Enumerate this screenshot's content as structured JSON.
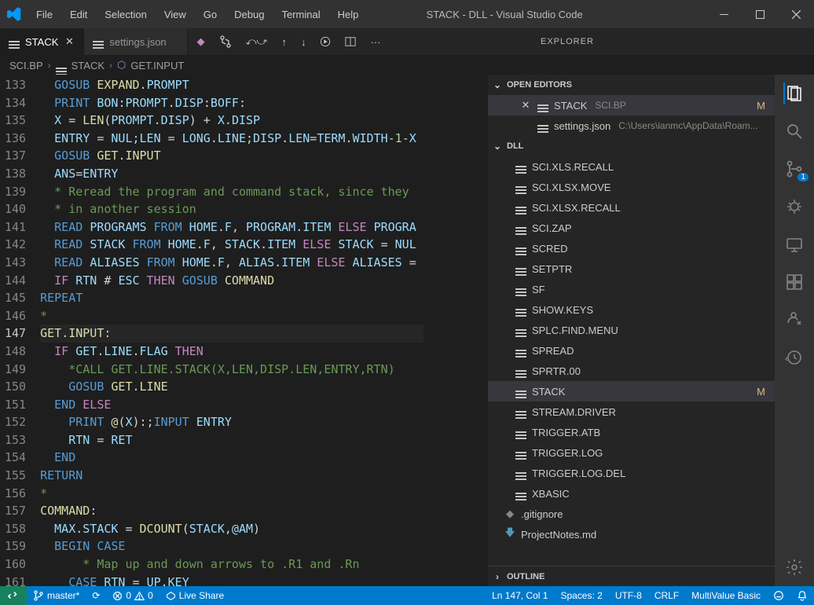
{
  "titlebar": {
    "menus": [
      "File",
      "Edit",
      "Selection",
      "View",
      "Go",
      "Debug",
      "Terminal",
      "Help"
    ],
    "title": "STACK - DLL - Visual Studio Code"
  },
  "tabs": [
    {
      "label": "STACK",
      "active": true,
      "dirty": false,
      "close": true
    },
    {
      "label": "settings.json",
      "active": false,
      "dirty": false,
      "close": false
    }
  ],
  "panel_title": "EXPLORER",
  "breadcrumb": [
    "SCI.BP",
    "STACK",
    "GET.INPUT"
  ],
  "line_numbers": [
    133,
    134,
    135,
    136,
    137,
    138,
    139,
    140,
    141,
    142,
    143,
    144,
    145,
    146,
    147,
    148,
    149,
    150,
    151,
    152,
    153,
    154,
    155,
    156,
    157,
    158,
    159,
    160,
    161
  ],
  "active_line_number": 147,
  "code_lines": [
    [
      [
        "  ",
        "op"
      ],
      [
        "GOSUB ",
        "kw"
      ],
      [
        "EXPAND",
        "fn"
      ],
      [
        ".",
        "op"
      ],
      [
        "PROMPT",
        "var"
      ]
    ],
    [
      [
        "  ",
        "op"
      ],
      [
        "PRINT ",
        "kw"
      ],
      [
        "BON",
        "var"
      ],
      [
        ":",
        "op"
      ],
      [
        "PROMPT",
        "var"
      ],
      [
        ".",
        "op"
      ],
      [
        "DISP",
        "var"
      ],
      [
        ":",
        "op"
      ],
      [
        "BOFF",
        "var"
      ],
      [
        ":",
        "op"
      ]
    ],
    [
      [
        "  ",
        "op"
      ],
      [
        "X",
        "var"
      ],
      [
        " = ",
        "op"
      ],
      [
        "LEN",
        "fn"
      ],
      [
        "(",
        "op"
      ],
      [
        "PROMPT",
        "var"
      ],
      [
        ".",
        "op"
      ],
      [
        "DISP",
        "var"
      ],
      [
        ")",
        "op"
      ],
      [
        " + ",
        "op"
      ],
      [
        "X",
        "var"
      ],
      [
        ".",
        "op"
      ],
      [
        "DISP",
        "var"
      ]
    ],
    [
      [
        "  ",
        "op"
      ],
      [
        "ENTRY",
        "var"
      ],
      [
        " = ",
        "op"
      ],
      [
        "NUL",
        "var"
      ],
      [
        ";",
        "op"
      ],
      [
        "LEN",
        "var"
      ],
      [
        " = ",
        "op"
      ],
      [
        "LONG",
        "var"
      ],
      [
        ".",
        "op"
      ],
      [
        "LINE",
        "var"
      ],
      [
        ";",
        "op"
      ],
      [
        "DISP",
        "var"
      ],
      [
        ".",
        "op"
      ],
      [
        "LEN",
        "var"
      ],
      [
        "=",
        "op"
      ],
      [
        "TERM",
        "var"
      ],
      [
        ".",
        "op"
      ],
      [
        "WIDTH",
        "var"
      ],
      [
        "-",
        "op"
      ],
      [
        "1",
        "num"
      ],
      [
        "-",
        "op"
      ],
      [
        "X",
        "var"
      ]
    ],
    [
      [
        "  ",
        "op"
      ],
      [
        "GOSUB ",
        "kw"
      ],
      [
        "GET",
        "fn"
      ],
      [
        ".",
        "op"
      ],
      [
        "INPUT",
        "fn"
      ]
    ],
    [
      [
        "  ",
        "op"
      ],
      [
        "ANS",
        "var"
      ],
      [
        "=",
        "op"
      ],
      [
        "ENTRY",
        "var"
      ]
    ],
    [
      [
        "  ",
        "op"
      ],
      [
        "* Reread the program and command stack, since they ",
        "cmt"
      ]
    ],
    [
      [
        "  ",
        "op"
      ],
      [
        "* in another session",
        "cmt"
      ]
    ],
    [
      [
        "  ",
        "op"
      ],
      [
        "READ ",
        "kw"
      ],
      [
        "PROGRAMS ",
        "var"
      ],
      [
        "FROM ",
        "kw"
      ],
      [
        "HOME",
        "var"
      ],
      [
        ".",
        "op"
      ],
      [
        "F",
        "var"
      ],
      [
        ", ",
        "op"
      ],
      [
        "PROGRAM",
        "var"
      ],
      [
        ".",
        "op"
      ],
      [
        "ITEM",
        "var"
      ],
      [
        " ELSE ",
        "kw2"
      ],
      [
        "PROGRA",
        "var"
      ]
    ],
    [
      [
        "  ",
        "op"
      ],
      [
        "READ ",
        "kw"
      ],
      [
        "STACK ",
        "var"
      ],
      [
        "FROM ",
        "kw"
      ],
      [
        "HOME",
        "var"
      ],
      [
        ".",
        "op"
      ],
      [
        "F",
        "var"
      ],
      [
        ", ",
        "op"
      ],
      [
        "STACK",
        "var"
      ],
      [
        ".",
        "op"
      ],
      [
        "ITEM",
        "var"
      ],
      [
        " ELSE ",
        "kw2"
      ],
      [
        "STACK",
        "var"
      ],
      [
        " = ",
        "op"
      ],
      [
        "NUL",
        "var"
      ]
    ],
    [
      [
        "  ",
        "op"
      ],
      [
        "READ ",
        "kw"
      ],
      [
        "ALIASES ",
        "var"
      ],
      [
        "FROM ",
        "kw"
      ],
      [
        "HOME",
        "var"
      ],
      [
        ".",
        "op"
      ],
      [
        "F",
        "var"
      ],
      [
        ", ",
        "op"
      ],
      [
        "ALIAS",
        "var"
      ],
      [
        ".",
        "op"
      ],
      [
        "ITEM",
        "var"
      ],
      [
        " ELSE ",
        "kw2"
      ],
      [
        "ALIASES",
        "var"
      ],
      [
        " = ",
        "op"
      ]
    ],
    [
      [
        "  ",
        "op"
      ],
      [
        "IF ",
        "kw2"
      ],
      [
        "RTN",
        "var"
      ],
      [
        " # ",
        "op"
      ],
      [
        "ESC",
        "var"
      ],
      [
        " THEN ",
        "kw2"
      ],
      [
        "GOSUB ",
        "kw"
      ],
      [
        "COMMAND",
        "fn"
      ]
    ],
    [
      [
        "REPEAT",
        "kw"
      ]
    ],
    [
      [
        "*",
        "cmt"
      ]
    ],
    [
      [
        "GET",
        "lbl"
      ],
      [
        ".",
        "op"
      ],
      [
        "INPUT",
        "lbl"
      ],
      [
        ":",
        "op"
      ]
    ],
    [
      [
        "  ",
        "op"
      ],
      [
        "IF ",
        "kw2"
      ],
      [
        "GET",
        "var"
      ],
      [
        ".",
        "op"
      ],
      [
        "LINE",
        "var"
      ],
      [
        ".",
        "op"
      ],
      [
        "FLAG",
        "var"
      ],
      [
        " THEN",
        "kw2"
      ]
    ],
    [
      [
        "    ",
        "op"
      ],
      [
        "*CALL GET.LINE.STACK(X,LEN,DISP.LEN,ENTRY,RTN)",
        "cmt"
      ]
    ],
    [
      [
        "    ",
        "op"
      ],
      [
        "GOSUB ",
        "kw"
      ],
      [
        "GET",
        "fn"
      ],
      [
        ".",
        "op"
      ],
      [
        "LINE",
        "fn"
      ]
    ],
    [
      [
        "  ",
        "op"
      ],
      [
        "END ",
        "kw"
      ],
      [
        "ELSE",
        "kw2"
      ]
    ],
    [
      [
        "    ",
        "op"
      ],
      [
        "PRINT ",
        "kw"
      ],
      [
        "@",
        "fn"
      ],
      [
        "(",
        "op"
      ],
      [
        "X",
        "var"
      ],
      [
        ")",
        "op"
      ],
      [
        ":",
        "op"
      ],
      [
        ";",
        "op"
      ],
      [
        "INPUT ",
        "kw"
      ],
      [
        "ENTRY",
        "var"
      ]
    ],
    [
      [
        "    ",
        "op"
      ],
      [
        "RTN",
        "var"
      ],
      [
        " = ",
        "op"
      ],
      [
        "RET",
        "var"
      ]
    ],
    [
      [
        "  ",
        "op"
      ],
      [
        "END",
        "kw"
      ]
    ],
    [
      [
        "RETURN",
        "kw"
      ]
    ],
    [
      [
        "*",
        "cmt"
      ]
    ],
    [
      [
        "COMMAND",
        "lbl"
      ],
      [
        ":",
        "op"
      ]
    ],
    [
      [
        "  ",
        "op"
      ],
      [
        "MAX",
        "var"
      ],
      [
        ".",
        "op"
      ],
      [
        "STACK",
        "var"
      ],
      [
        " = ",
        "op"
      ],
      [
        "DCOUNT",
        "fn"
      ],
      [
        "(",
        "op"
      ],
      [
        "STACK",
        "var"
      ],
      [
        ",",
        "op"
      ],
      [
        "@AM",
        "var"
      ],
      [
        ")",
        "op"
      ]
    ],
    [
      [
        "  ",
        "op"
      ],
      [
        "BEGIN CASE",
        "kw"
      ]
    ],
    [
      [
        "      ",
        "op"
      ],
      [
        "* Map up and down arrows to .R1 and .Rn",
        "cmt"
      ]
    ],
    [
      [
        "    ",
        "op"
      ],
      [
        "CASE ",
        "kw"
      ],
      [
        "RTN",
        "var"
      ],
      [
        " = ",
        "op"
      ],
      [
        "UP",
        "var"
      ],
      [
        ".",
        "op"
      ],
      [
        "KEY",
        "var"
      ]
    ]
  ],
  "open_editors": {
    "title": "OPEN EDITORS",
    "items": [
      {
        "name": "STACK",
        "sub": "SCI.BP",
        "dirty": "M",
        "active": true,
        "close": true
      },
      {
        "name": "settings.json",
        "sub": "C:\\Users\\ianmc\\AppData\\Roam...",
        "dirty": "",
        "active": false,
        "close": false
      }
    ]
  },
  "folder": {
    "title": "DLL",
    "items": [
      {
        "name": "SCI.XLS.RECALL",
        "dirty": ""
      },
      {
        "name": "SCI.XLSX.MOVE",
        "dirty": ""
      },
      {
        "name": "SCI.XLSX.RECALL",
        "dirty": ""
      },
      {
        "name": "SCI.ZAP",
        "dirty": ""
      },
      {
        "name": "SCRED",
        "dirty": ""
      },
      {
        "name": "SETPTR",
        "dirty": ""
      },
      {
        "name": "SF",
        "dirty": ""
      },
      {
        "name": "SHOW.KEYS",
        "dirty": ""
      },
      {
        "name": "SPLC.FIND.MENU",
        "dirty": ""
      },
      {
        "name": "SPREAD",
        "dirty": ""
      },
      {
        "name": "SPRTR.00",
        "dirty": ""
      },
      {
        "name": "STACK",
        "dirty": "M",
        "active": true
      },
      {
        "name": "STREAM.DRIVER",
        "dirty": ""
      },
      {
        "name": "TRIGGER.ATB",
        "dirty": ""
      },
      {
        "name": "TRIGGER.LOG",
        "dirty": ""
      },
      {
        "name": "TRIGGER.LOG.DEL",
        "dirty": ""
      },
      {
        "name": "XBASIC",
        "dirty": ""
      }
    ],
    "root_items": [
      {
        "name": ".gitignore",
        "icon": "gitignore"
      },
      {
        "name": "ProjectNotes.md",
        "icon": "markdown"
      }
    ]
  },
  "outline": "OUTLINE",
  "source_control_badge": "1",
  "status": {
    "branch": "master*",
    "sync": "⟳",
    "errors": "0",
    "warnings": "0",
    "liveshare": "Live Share",
    "pos": "Ln 147, Col 1",
    "spaces": "Spaces: 2",
    "encoding": "UTF-8",
    "eol": "CRLF",
    "lang": "MultiValue Basic"
  }
}
